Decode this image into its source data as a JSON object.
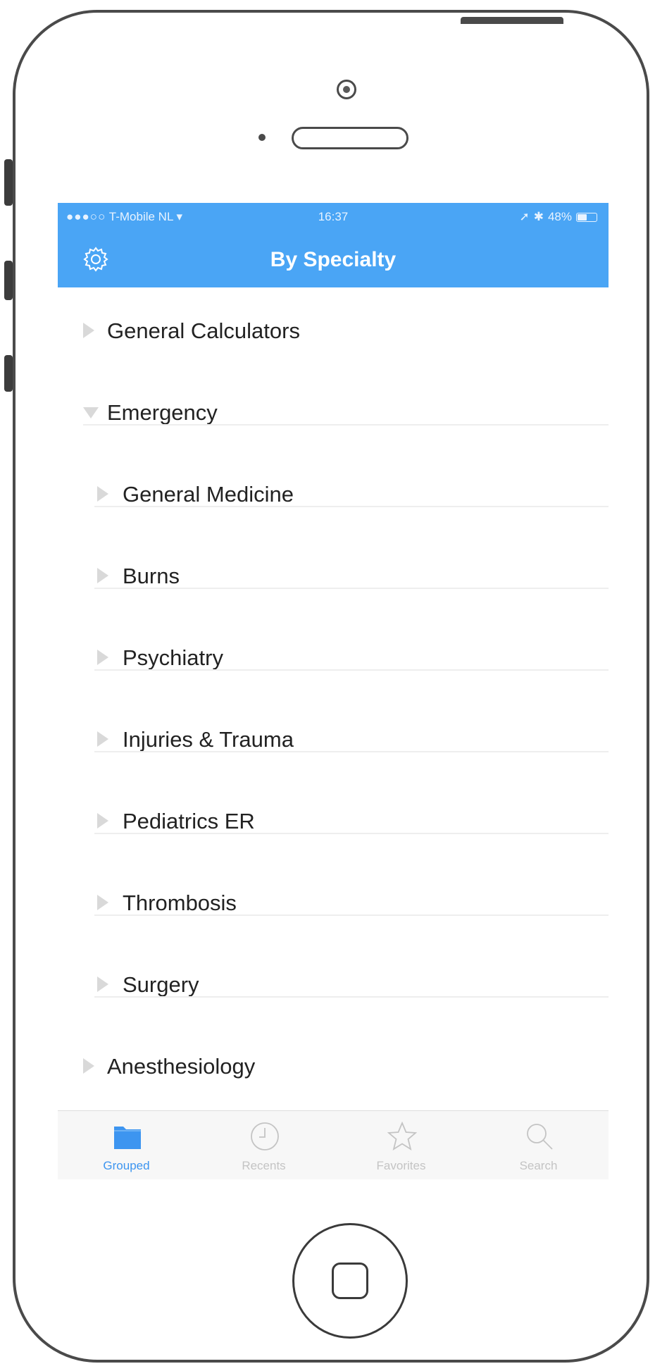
{
  "status_bar": {
    "carrier": "T-Mobile NL",
    "time": "16:37",
    "battery": "48%",
    "battery_level": 0.48
  },
  "nav": {
    "title": "By Specialty",
    "settings_icon": "gear-icon"
  },
  "list": {
    "items": [
      {
        "label": "General Calculators",
        "expanded": false,
        "level": 0
      },
      {
        "label": "Emergency",
        "expanded": true,
        "level": 0
      },
      {
        "label": "General Medicine",
        "expanded": false,
        "level": 1
      },
      {
        "label": "Burns",
        "expanded": false,
        "level": 1
      },
      {
        "label": "Psychiatry",
        "expanded": false,
        "level": 1
      },
      {
        "label": "Injuries & Trauma",
        "expanded": false,
        "level": 1
      },
      {
        "label": "Pediatrics ER",
        "expanded": false,
        "level": 1
      },
      {
        "label": "Thrombosis",
        "expanded": false,
        "level": 1
      },
      {
        "label": "Surgery",
        "expanded": false,
        "level": 1
      },
      {
        "label": "Anesthesiology",
        "expanded": false,
        "level": 0
      }
    ]
  },
  "tabs": [
    {
      "label": "Grouped",
      "icon": "folder-icon",
      "active": true
    },
    {
      "label": "Recents",
      "icon": "clock-icon",
      "active": false
    },
    {
      "label": "Favorites",
      "icon": "star-icon",
      "active": false
    },
    {
      "label": "Search",
      "icon": "search-icon",
      "active": false
    }
  ],
  "colors": {
    "accent": "#4aa5f5",
    "tab_active": "#3d95f0",
    "tab_inactive": "#c4c4c4"
  }
}
